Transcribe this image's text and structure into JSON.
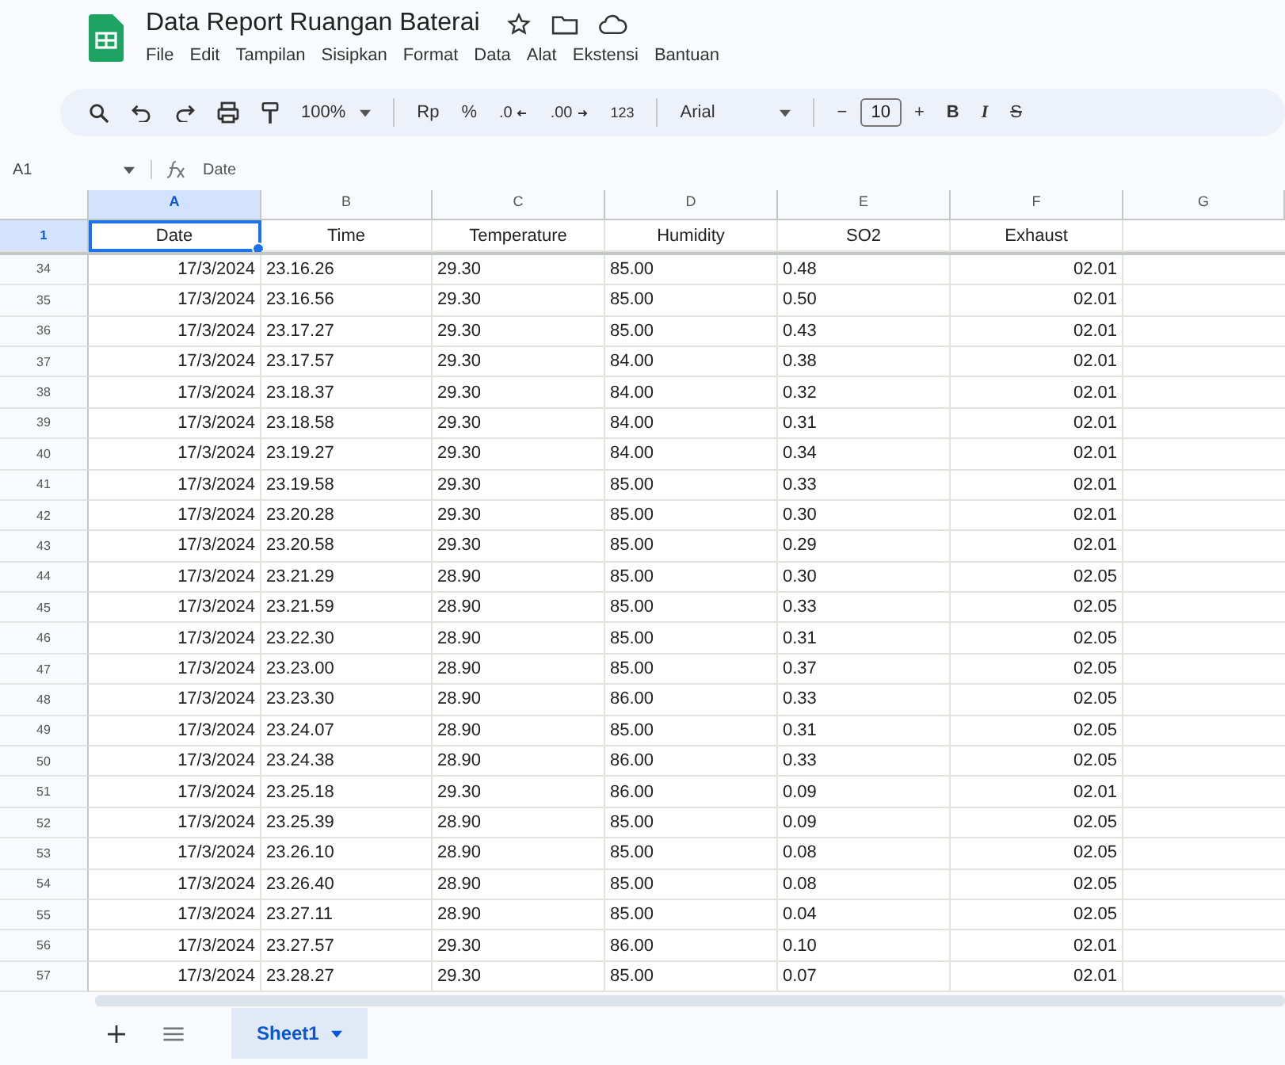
{
  "document": {
    "title": "Data Report Ruangan Baterai"
  },
  "menu": [
    "File",
    "Edit",
    "Tampilan",
    "Sisipkan",
    "Format",
    "Data",
    "Alat",
    "Ekstensi",
    "Bantuan"
  ],
  "toolbar": {
    "zoom": "100%",
    "currency": "Rp",
    "percent": "%",
    "decrease_decimal": ".0",
    "increase_decimal": ".00",
    "number_format": "123",
    "font": "Arial",
    "font_size_minus": "−",
    "font_size": "10",
    "font_size_plus": "+",
    "bold": "B",
    "italic": "I",
    "strikethrough": "S"
  },
  "formula_bar": {
    "cell_ref": "A1",
    "formula": "Date"
  },
  "columns": [
    {
      "label": "A",
      "selected": true
    },
    {
      "label": "B",
      "selected": false
    },
    {
      "label": "C",
      "selected": false
    },
    {
      "label": "D",
      "selected": false
    },
    {
      "label": "E",
      "selected": false
    },
    {
      "label": "F",
      "selected": false
    },
    {
      "label": "G",
      "selected": false
    }
  ],
  "header_row": {
    "number": "1",
    "selected": true,
    "cells": [
      {
        "text": "Date",
        "selected": true
      },
      {
        "text": "Time",
        "selected": false
      },
      {
        "text": "Temperature",
        "selected": false
      },
      {
        "text": "Humidity",
        "selected": false
      },
      {
        "text": "SO2",
        "selected": false
      },
      {
        "text": "Exhaust",
        "selected": false
      }
    ]
  },
  "rows": [
    {
      "number": "34",
      "cells": [
        "17/3/2024",
        "23.16.26",
        "29.30",
        "85.00",
        "0.48",
        "02.01"
      ]
    },
    {
      "number": "35",
      "cells": [
        "17/3/2024",
        "23.16.56",
        "29.30",
        "85.00",
        "0.50",
        "02.01"
      ]
    },
    {
      "number": "36",
      "cells": [
        "17/3/2024",
        "23.17.27",
        "29.30",
        "85.00",
        "0.43",
        "02.01"
      ]
    },
    {
      "number": "37",
      "cells": [
        "17/3/2024",
        "23.17.57",
        "29.30",
        "84.00",
        "0.38",
        "02.01"
      ]
    },
    {
      "number": "38",
      "cells": [
        "17/3/2024",
        "23.18.37",
        "29.30",
        "84.00",
        "0.32",
        "02.01"
      ]
    },
    {
      "number": "39",
      "cells": [
        "17/3/2024",
        "23.18.58",
        "29.30",
        "84.00",
        "0.31",
        "02.01"
      ]
    },
    {
      "number": "40",
      "cells": [
        "17/3/2024",
        "23.19.27",
        "29.30",
        "84.00",
        "0.34",
        "02.01"
      ]
    },
    {
      "number": "41",
      "cells": [
        "17/3/2024",
        "23.19.58",
        "29.30",
        "85.00",
        "0.33",
        "02.01"
      ]
    },
    {
      "number": "42",
      "cells": [
        "17/3/2024",
        "23.20.28",
        "29.30",
        "85.00",
        "0.30",
        "02.01"
      ]
    },
    {
      "number": "43",
      "cells": [
        "17/3/2024",
        "23.20.58",
        "29.30",
        "85.00",
        "0.29",
        "02.01"
      ]
    },
    {
      "number": "44",
      "cells": [
        "17/3/2024",
        "23.21.29",
        "28.90",
        "85.00",
        "0.30",
        "02.05"
      ]
    },
    {
      "number": "45",
      "cells": [
        "17/3/2024",
        "23.21.59",
        "28.90",
        "85.00",
        "0.33",
        "02.05"
      ]
    },
    {
      "number": "46",
      "cells": [
        "17/3/2024",
        "23.22.30",
        "28.90",
        "85.00",
        "0.31",
        "02.05"
      ]
    },
    {
      "number": "47",
      "cells": [
        "17/3/2024",
        "23.23.00",
        "28.90",
        "85.00",
        "0.37",
        "02.05"
      ]
    },
    {
      "number": "48",
      "cells": [
        "17/3/2024",
        "23.23.30",
        "28.90",
        "86.00",
        "0.33",
        "02.05"
      ]
    },
    {
      "number": "49",
      "cells": [
        "17/3/2024",
        "23.24.07",
        "28.90",
        "85.00",
        "0.31",
        "02.05"
      ]
    },
    {
      "number": "50",
      "cells": [
        "17/3/2024",
        "23.24.38",
        "28.90",
        "86.00",
        "0.33",
        "02.05"
      ]
    },
    {
      "number": "51",
      "cells": [
        "17/3/2024",
        "23.25.18",
        "29.30",
        "86.00",
        "0.09",
        "02.01"
      ]
    },
    {
      "number": "52",
      "cells": [
        "17/3/2024",
        "23.25.39",
        "28.90",
        "85.00",
        "0.09",
        "02.05"
      ]
    },
    {
      "number": "53",
      "cells": [
        "17/3/2024",
        "23.26.10",
        "28.90",
        "85.00",
        "0.08",
        "02.05"
      ]
    },
    {
      "number": "54",
      "cells": [
        "17/3/2024",
        "23.26.40",
        "28.90",
        "85.00",
        "0.08",
        "02.05"
      ]
    },
    {
      "number": "55",
      "cells": [
        "17/3/2024",
        "23.27.11",
        "28.90",
        "85.00",
        "0.04",
        "02.05"
      ]
    },
    {
      "number": "56",
      "cells": [
        "17/3/2024",
        "23.27.57",
        "29.30",
        "86.00",
        "0.10",
        "02.01"
      ]
    },
    {
      "number": "57",
      "cells": [
        "17/3/2024",
        "23.28.27",
        "29.30",
        "85.00",
        "0.07",
        "02.01"
      ]
    }
  ],
  "sheet_tabs": [
    {
      "label": "Sheet1",
      "selected": true
    }
  ]
}
